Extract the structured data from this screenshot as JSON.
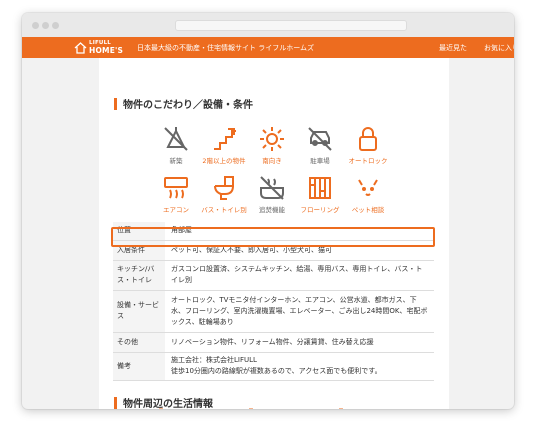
{
  "header": {
    "logo_small": "LIFULL",
    "logo_big": "HOME'S",
    "tagline": "日本最大級の不動産・住宅情報サイト ライフルホームズ",
    "nav_recent": "最近見た",
    "nav_favorites": "お気に入り"
  },
  "section1": {
    "title": "物件のこだわり／設備・条件"
  },
  "features": [
    {
      "label": "新築",
      "icon": "new-build-icon",
      "active": false
    },
    {
      "label": "2階以上の物件",
      "icon": "stairs-icon",
      "active": true
    },
    {
      "label": "南向き",
      "icon": "sun-icon",
      "active": true
    },
    {
      "label": "駐車場",
      "icon": "car-icon",
      "active": false
    },
    {
      "label": "オートロック",
      "icon": "lock-icon",
      "active": true
    },
    {
      "label": "エアコン",
      "icon": "air-conditioner-icon",
      "active": true
    },
    {
      "label": "バス・トイレ別",
      "icon": "toilet-icon",
      "active": true
    },
    {
      "label": "追焚機能",
      "icon": "bath-reheat-icon",
      "active": false
    },
    {
      "label": "フローリング",
      "icon": "flooring-icon",
      "active": true
    },
    {
      "label": "ペット相談",
      "icon": "pet-icon",
      "active": true
    }
  ],
  "spec_table": [
    {
      "label": "位置",
      "value": "角部屋"
    },
    {
      "label": "入居条件",
      "value": "ペット可、保証人不要、即入居可、小型犬可、猫可"
    },
    {
      "label": "キッチン/バス・トイレ",
      "value": "ガスコンロ設置済、システムキッチン、給湯、専用バス、専用トイレ、バス・トイレ別"
    },
    {
      "label": "設備・サービス",
      "value": "オートロック、TVモニタ付インターホン、エアコン、公営水道、都市ガス、下水、フローリング、室内洗濯機置場、エレベーター、ごみ出し24時間OK、宅配ボックス、駐輪場あり"
    },
    {
      "label": "その他",
      "value": "リノベーション物件、リフォーム物件、分譲賃貸、住み替え応援"
    },
    {
      "label": "備考",
      "value_line1": "施工会社：株式会社LIFULL",
      "value_line2": "徒歩10分圏内の路線駅が複数あるので、アクセス面でも便利です。"
    }
  ],
  "section2": {
    "title": "物件周辺の生活情報"
  },
  "colors": {
    "accent": "#ed6c1f",
    "inactive": "#666666"
  }
}
